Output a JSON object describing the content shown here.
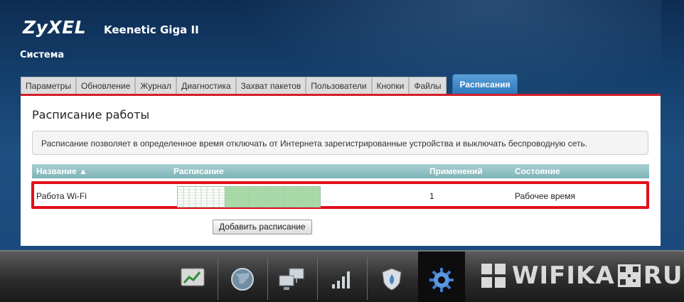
{
  "header": {
    "brand": "ZyXEL",
    "model": "Keenetic Giga II",
    "section": "Система"
  },
  "tabs": [
    {
      "label": "Параметры"
    },
    {
      "label": "Обновление"
    },
    {
      "label": "Журнал"
    },
    {
      "label": "Диагностика"
    },
    {
      "label": "Захват пакетов"
    },
    {
      "label": "Пользователи"
    },
    {
      "label": "Кнопки"
    },
    {
      "label": "Файлы"
    },
    {
      "label": "Расписания",
      "active": true
    }
  ],
  "panel": {
    "title": "Расписание работы",
    "info": "Расписание позволяет в определенное время отключать от Интернета зарегистрированные устройства и выключать беспроводную сеть.",
    "columns": {
      "name": "Название ▲",
      "schedule": "Расписание",
      "applied": "Применений",
      "state": "Состояние"
    },
    "row": {
      "name": "Работа Wi-Fi",
      "applied": "1",
      "state": "Рабочее время"
    },
    "add_button": "Добавить расписание"
  },
  "taskbar": {
    "icons": [
      "monitor-chart-icon",
      "globe-icon",
      "network-computers-icon",
      "signal-bars-icon",
      "shield-flame-icon",
      "gear-icon"
    ],
    "active_icon": "gear-icon"
  },
  "watermark": {
    "text": "WIFIKA",
    "suffix": "RU"
  },
  "colors": {
    "accent_red": "#d21e2a",
    "tab_active": "#2e78bd",
    "schedule_active": "#a8dba8"
  }
}
